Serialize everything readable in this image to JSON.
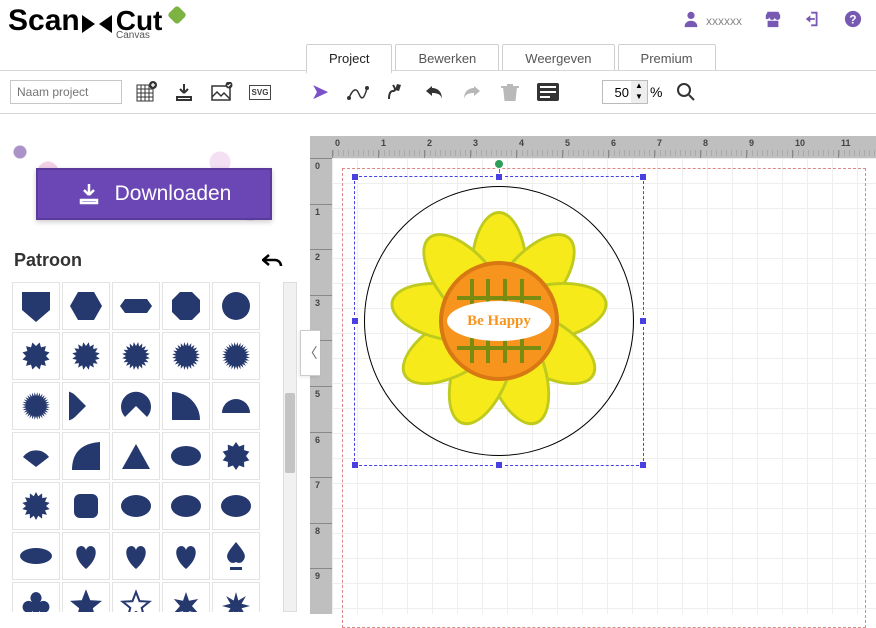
{
  "app": {
    "logo_a": "Scan",
    "logo_b": "Cut",
    "logo_sub": "Canvas"
  },
  "user": {
    "name": "xxxxxx"
  },
  "tabs": [
    {
      "label": "Project",
      "active": true
    },
    {
      "label": "Bewerken",
      "active": false
    },
    {
      "label": "Weergeven",
      "active": false
    },
    {
      "label": "Premium",
      "active": false
    }
  ],
  "toolbar": {
    "project_name_placeholder": "Naam project",
    "svg_badge": "SVG",
    "zoom_value": "50",
    "zoom_suffix": "%"
  },
  "download_label": "Downloaden",
  "panel": {
    "title": "Patroon"
  },
  "canvas": {
    "design_text": "Be Happy",
    "ruler_h": [
      "0",
      "1",
      "2",
      "3",
      "4",
      "5",
      "6",
      "7",
      "8",
      "9",
      "10",
      "11"
    ],
    "ruler_v": [
      "0",
      "1",
      "2",
      "3",
      "4",
      "5",
      "6",
      "7",
      "8",
      "9"
    ]
  },
  "shapes": [
    "shield",
    "hexagon",
    "hex-wide",
    "octagon",
    "circle",
    "burst12",
    "burst16",
    "burst20",
    "burst-round",
    "burst-soft",
    "seal",
    "pac-left",
    "pac-up",
    "quarter",
    "semicircle",
    "fan",
    "fin",
    "triangle",
    "ellipse",
    "splat",
    "splat2",
    "scallop-sq",
    "scallop-ellipse",
    "cloud",
    "cloud2",
    "oval",
    "heart",
    "heart-deco",
    "heart-swirl",
    "spade",
    "club",
    "star",
    "star-outline",
    "star6",
    "star8"
  ]
}
